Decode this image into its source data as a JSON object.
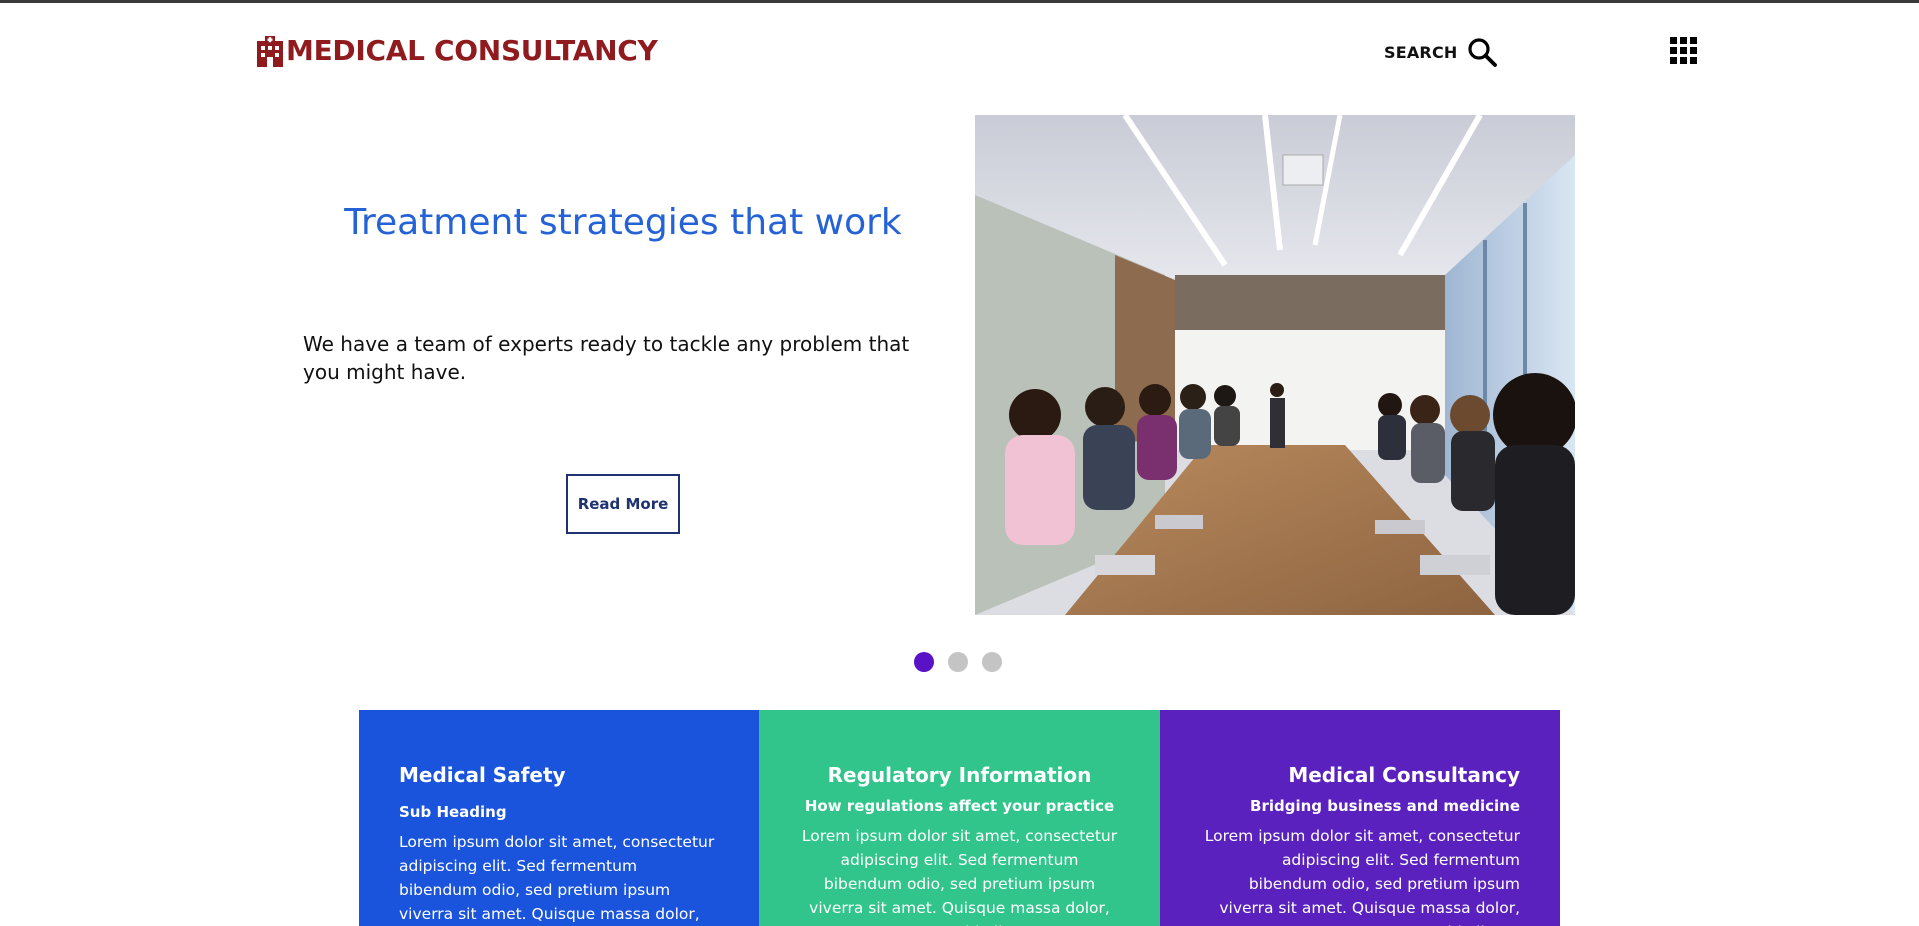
{
  "header": {
    "logo_text": "MEDICAL CONSULTANCY",
    "logo_icon": "hospital-building-icon",
    "search_label": "SEARCH",
    "search_icon": "search-icon",
    "menu_icon": "grid-menu-icon",
    "brand_color": "#8f1b1f"
  },
  "hero": {
    "title": "Treatment strategies that work",
    "text": "We have a team of experts ready to tackle any problem that you might have.",
    "button_label": "Read More",
    "image_alt": "meeting-room-photo",
    "title_color": "#2462d6"
  },
  "carousel": {
    "slide_count": 3,
    "active_index": 0,
    "active_color": "#5a12c6",
    "inactive_color": "#c4c4c4"
  },
  "cards": [
    {
      "title": "Medical Safety",
      "subtitle": "Sub Heading",
      "body": "Lorem ipsum dolor sit amet, consectetur adipiscing elit. Sed fermentum bibendum odio, sed pretium ipsum viverra sit amet. Quisque massa dolor, accumsan id aliquet",
      "color": "#1b54dc"
    },
    {
      "title": "Regulatory Information",
      "subtitle": "How regulations affect your practice",
      "body": "Lorem ipsum dolor sit amet, consectetur adipiscing elit. Sed fermentum bibendum odio, sed pretium ipsum viverra sit amet. Quisque massa dolor, accumsan id aliquet",
      "color": "#31c58b"
    },
    {
      "title": "Medical Consultancy",
      "subtitle": "Bridging business and medicine",
      "body": "Lorem ipsum dolor sit amet, consectetur adipiscing elit. Sed fermentum bibendum odio, sed pretium ipsum viverra sit amet. Quisque massa dolor, accumsan id aliquet",
      "color": "#5a21be"
    }
  ]
}
